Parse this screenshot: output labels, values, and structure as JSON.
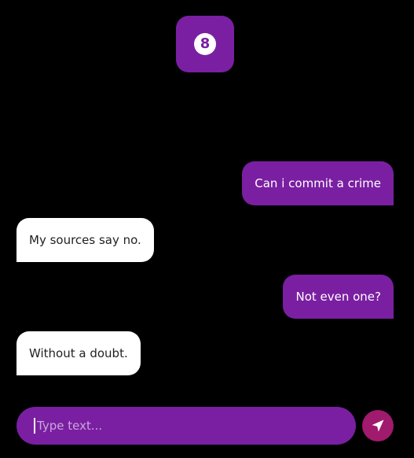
{
  "app": {
    "logo_glyph": "8",
    "accent_color": "#7a1fa2",
    "send_color": "#a01a6e"
  },
  "messages": [
    {
      "sender": "user",
      "text": "Can i commit a crime"
    },
    {
      "sender": "bot",
      "text": "My sources say no."
    },
    {
      "sender": "user",
      "text": "Not even one?"
    },
    {
      "sender": "bot",
      "text": "Without a doubt."
    }
  ],
  "composer": {
    "placeholder": "Type text...",
    "value": "",
    "send_icon": "send-icon"
  }
}
